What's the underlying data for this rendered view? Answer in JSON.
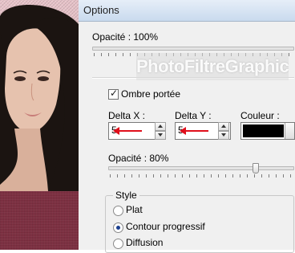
{
  "window": {
    "title": "Options"
  },
  "watermark": "PhotoFiltreGraphic",
  "opacity_top": {
    "label": "Opacité : 100%",
    "value": 100
  },
  "shadow": {
    "checkbox_label": "Ombre portée",
    "checked": true,
    "delta_x_label": "Delta X :",
    "delta_x_value": "5",
    "delta_y_label": "Delta Y :",
    "delta_y_value": "5",
    "color_label": "Couleur :",
    "color_value": "#000000"
  },
  "opacity_shadow": {
    "label": "Opacité : 80%",
    "value": 80
  },
  "style": {
    "label": "Style",
    "options": [
      "Plat",
      "Contour progressif",
      "Diffusion"
    ],
    "selected": "Contour progressif"
  },
  "colors": {
    "arrow": "#e0101c",
    "shadow_swatch": "#000000"
  }
}
